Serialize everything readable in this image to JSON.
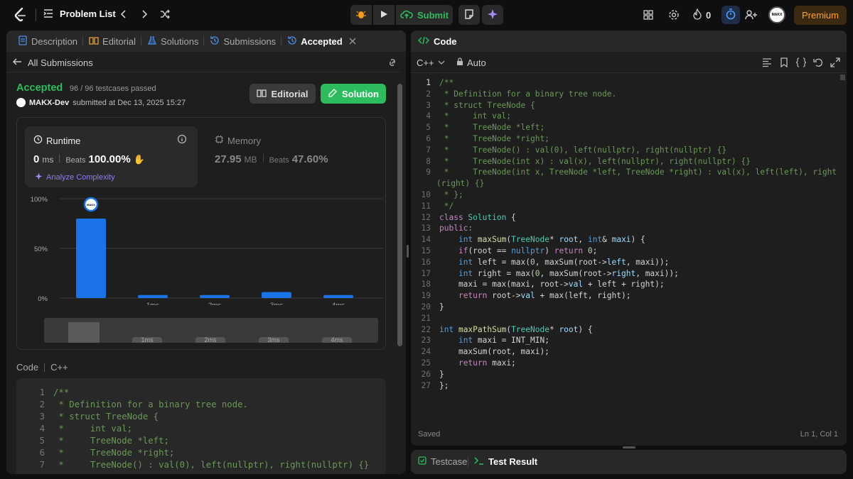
{
  "topbar": {
    "problem_list": "Problem List",
    "submit": "Submit",
    "streak": "0",
    "avatar_text": "MAKX",
    "premium": "Premium"
  },
  "left": {
    "tabs": [
      {
        "label": "Description",
        "icon": "description-icon"
      },
      {
        "label": "Editorial",
        "icon": "book-icon"
      },
      {
        "label": "Solutions",
        "icon": "flask-icon"
      },
      {
        "label": "Submissions",
        "icon": "history-icon"
      },
      {
        "label": "Accepted",
        "icon": "history-icon"
      }
    ],
    "back_label": "All Submissions",
    "status": "Accepted",
    "passed": "96 / 96 testcases passed",
    "user": "MAKX-Dev",
    "submitted_at": "submitted at Dec 13, 2025 15:27",
    "editorial_btn": "Editorial",
    "solution_btn": "Solution",
    "runtime": {
      "title": "Runtime",
      "value": "0",
      "unit": "ms",
      "beats_label": "Beats",
      "beats": "100.00%",
      "analyze": "Analyze Complexity"
    },
    "memory": {
      "title": "Memory",
      "value": "27.95",
      "unit": "MB",
      "beats_label": "Beats",
      "beats": "47.60%"
    },
    "chart_data": {
      "type": "bar",
      "categories": [
        "",
        "1ms",
        "2ms",
        "3ms",
        "4ms"
      ],
      "values": [
        80,
        3,
        3,
        6,
        3
      ],
      "yticks": [
        "100%",
        "50%",
        "0%"
      ],
      "ylim": [
        0,
        100
      ],
      "accent": "#1a73e8"
    },
    "minimap_labels": [
      "1ms",
      "2ms",
      "3ms",
      "4ms"
    ],
    "code_header": {
      "code": "Code",
      "lang": "C++"
    },
    "code_lines": [
      "/**",
      " * Definition for a binary tree node.",
      " * struct TreeNode {",
      " *     int val;",
      " *     TreeNode *left;",
      " *     TreeNode *right;",
      " *     TreeNode() : val(0), left(nullptr), right(nullptr) {}"
    ]
  },
  "right": {
    "title": "Code",
    "lang": "C++",
    "auto": "Auto",
    "saved": "Saved",
    "cursor": "Ln 1, Col 1",
    "testcase": "Testcase",
    "test_result": "Test Result"
  },
  "colors": {
    "accepted": "#2cbb5d",
    "accent": "#1a73e8",
    "premium": "#ffa116",
    "submit": "#2cbb5d"
  }
}
